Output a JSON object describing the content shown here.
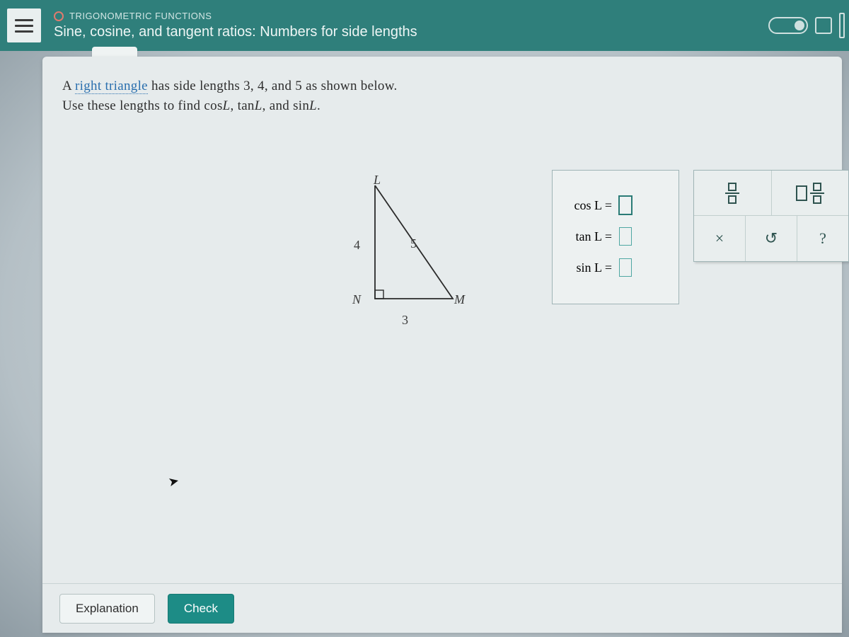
{
  "header": {
    "category": "TRIGONOMETRIC FUNCTIONS",
    "title": "Sine, cosine, and tangent ratios: Numbers for side lengths"
  },
  "problem": {
    "line1_pre": "A ",
    "line1_link": "right triangle",
    "line1_post": " has side lengths 3, 4, and 5 as shown below.",
    "line2_pre": "Use these lengths to find cos",
    "line2_mid1": ", tan",
    "line2_mid2": ", and sin",
    "line2_post": ".",
    "angle": "L"
  },
  "triangle": {
    "L": "L",
    "N": "N",
    "M": "M",
    "side_LN": "4",
    "side_LM": "5",
    "side_NM": "3"
  },
  "answers": {
    "row1": "cos L  =",
    "row2": "tan L  =",
    "row3": "sin L  ="
  },
  "tools": {
    "times": "×",
    "reset": "↺",
    "help": "?"
  },
  "footer": {
    "explanation": "Explanation",
    "check": "Check"
  },
  "prev": "⌄"
}
